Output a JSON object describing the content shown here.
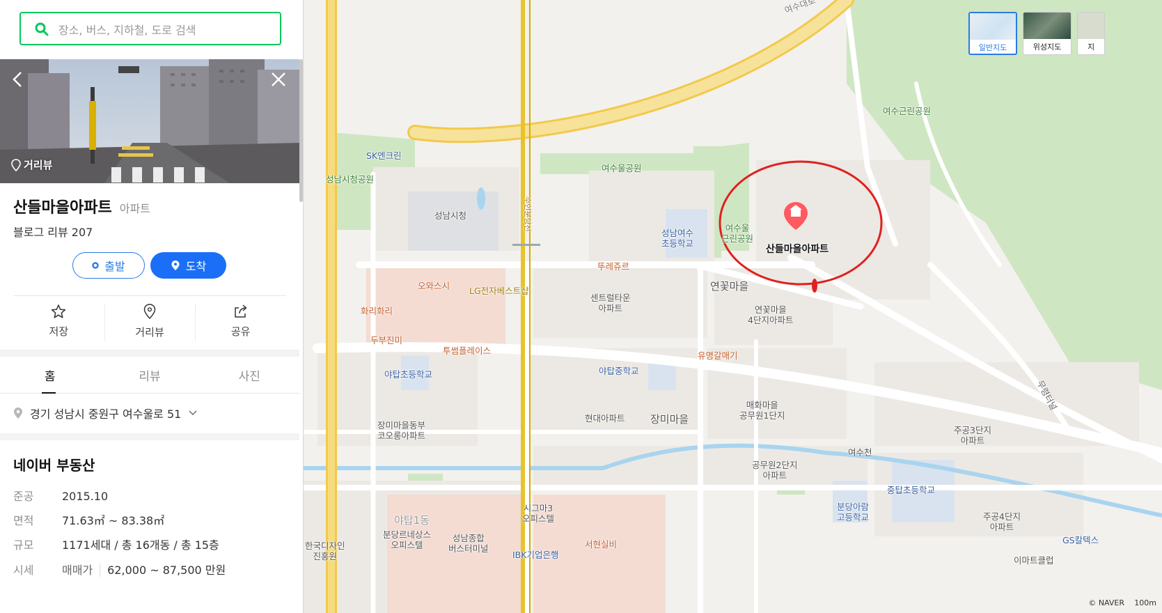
{
  "search": {
    "placeholder": "장소, 버스, 지하철, 도로 검색"
  },
  "photo": {
    "streetview_label": "거리뷰"
  },
  "place": {
    "name": "산들마을아파트",
    "category": "아파트",
    "blog_review": "블로그 리뷰 207",
    "depart_label": "출발",
    "arrive_label": "도착"
  },
  "actions": [
    {
      "label": "저장",
      "icon": "star-icon"
    },
    {
      "label": "거리뷰",
      "icon": "streetview-pin-icon"
    },
    {
      "label": "공유",
      "icon": "share-icon"
    }
  ],
  "tabs": [
    {
      "label": "홈",
      "active": true
    },
    {
      "label": "리뷰",
      "active": false
    },
    {
      "label": "사진",
      "active": false
    }
  ],
  "address": "경기 성남시 중원구 여수울로 51",
  "realestate": {
    "title": "네이버 부동산",
    "rows": [
      {
        "key": "준공",
        "value": "2015.10"
      },
      {
        "key": "면적",
        "value": "71.63㎡ ~ 83.38㎡"
      },
      {
        "key": "규모",
        "value": "1171세대 / 총 16개동 / 총 15층"
      },
      {
        "key": "시세",
        "sub": "매매가",
        "value": "62,000 ~ 87,500 만원"
      }
    ]
  },
  "map": {
    "types": [
      "일반지도",
      "위성지도",
      "지"
    ],
    "selected_label": "산들마을아파트",
    "labels": {
      "yeosu_park": "여수근린공원",
      "sk": "SK엔크린",
      "seongnam_park": "성남시청공원",
      "yeosuul_park": "여수울공원",
      "city_hall": "성남시청",
      "yeosuul_park2": "여수울\n근린공원",
      "yeosu_school": "성남여수\n초등학교",
      "ttureju": "뚜레쥬르",
      "owa_sushi": "오와스시",
      "lg": "LG전자베스트샵",
      "central": "센트럴타운\n아파트",
      "yeonkkot": "연꽃마을",
      "yeonkkot4": "연꽃마을\n4단지아파트",
      "hwari": "화리화리",
      "dubu": "두부진미",
      "tusseom": "투썸플레이스",
      "yumyeong": "유명갈매기",
      "yatap_elem": "야탑초등학교",
      "yatap_mid": "야탑중학교",
      "maehwa": "매화마을\n공무원1단지",
      "janmi_kolon": "장미마을동부\n코오롱아파트",
      "hyundai": "현대아파트",
      "jangmi": "장미마을",
      "jugong3": "주공3단지\n아파트",
      "yeosucheon": "여수천",
      "gongmuwon2": "공무원2단지\n아파트",
      "jungtap": "중탑초등학교",
      "bundang_arum": "분당아람\n고등학교",
      "jugong4": "주공4단지\n아파트",
      "sigma": "시그마3\n오피스텔",
      "bundang_office": "분당르네상스\n오피스텔",
      "terminal": "성남종합\n버스터미널",
      "design": "한국디자인\n진흥원",
      "seohyeon": "서현실비",
      "ibk": "IBK기업은행",
      "gs": "GS칼텍스",
      "imart": "이마트클럽",
      "yatap1": "야탑1동",
      "road_muryeong": "무령터널",
      "road_yeosu": "여수대로",
      "road_suin": "수인분당선"
    },
    "copyright": "© NAVER",
    "scale": "100m"
  },
  "colors": {
    "accent_green": "#03c75a",
    "accent_blue": "#1b6ff7",
    "highlight_red": "#e02020"
  }
}
